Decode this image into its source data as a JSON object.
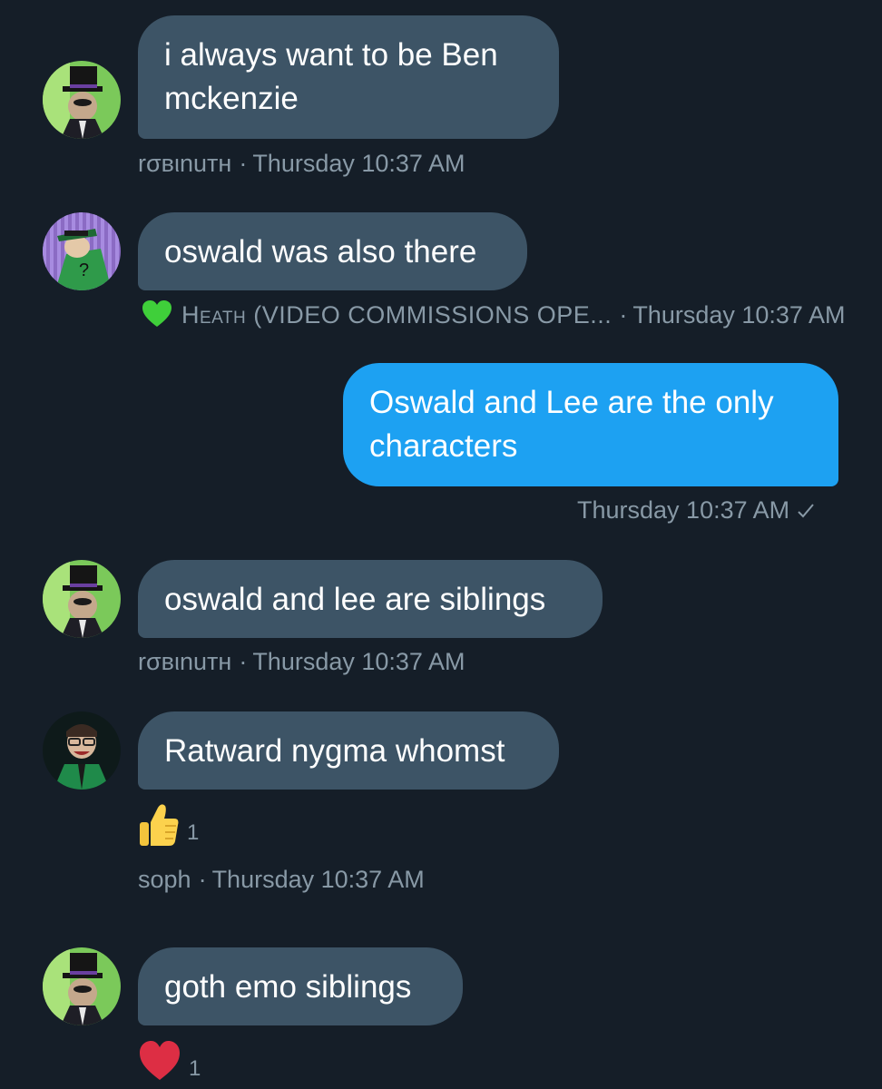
{
  "messages": [
    {
      "text_line1": "i always want to be Ben",
      "text_line2": "mckenzie",
      "author": "rσвιnuтн",
      "separator": "·",
      "time": "Thursday 10:37 AM"
    },
    {
      "text": "oswald was also there",
      "author_badge": "green-heart-icon",
      "author": "Heath (VIDEO COMMISSIONS OPE...",
      "separator": "·",
      "time": "Thursday 10:37 AM"
    },
    {
      "text_line1": "Oswald and Lee are the only",
      "text_line2": "characters",
      "time": "Thursday 10:37 AM",
      "status_icon": "sent-check-icon"
    },
    {
      "text": "oswald and lee are siblings",
      "author": "rσвιnuтн",
      "separator": "·",
      "time": "Thursday 10:37 AM"
    },
    {
      "text": "Ratward nygma whomst",
      "reaction_icon": "thumbs-up-icon",
      "reaction_count": "1",
      "author": "soph",
      "separator": "·",
      "time": "Thursday 10:37 AM"
    },
    {
      "text": "goth emo siblings",
      "reaction_icon": "red-heart-icon",
      "reaction_count": "1"
    }
  ],
  "colors": {
    "background": "#151e28",
    "incoming_bubble": "#3d5466",
    "outgoing_bubble": "#1da1f2",
    "meta_text": "#8899a6"
  }
}
